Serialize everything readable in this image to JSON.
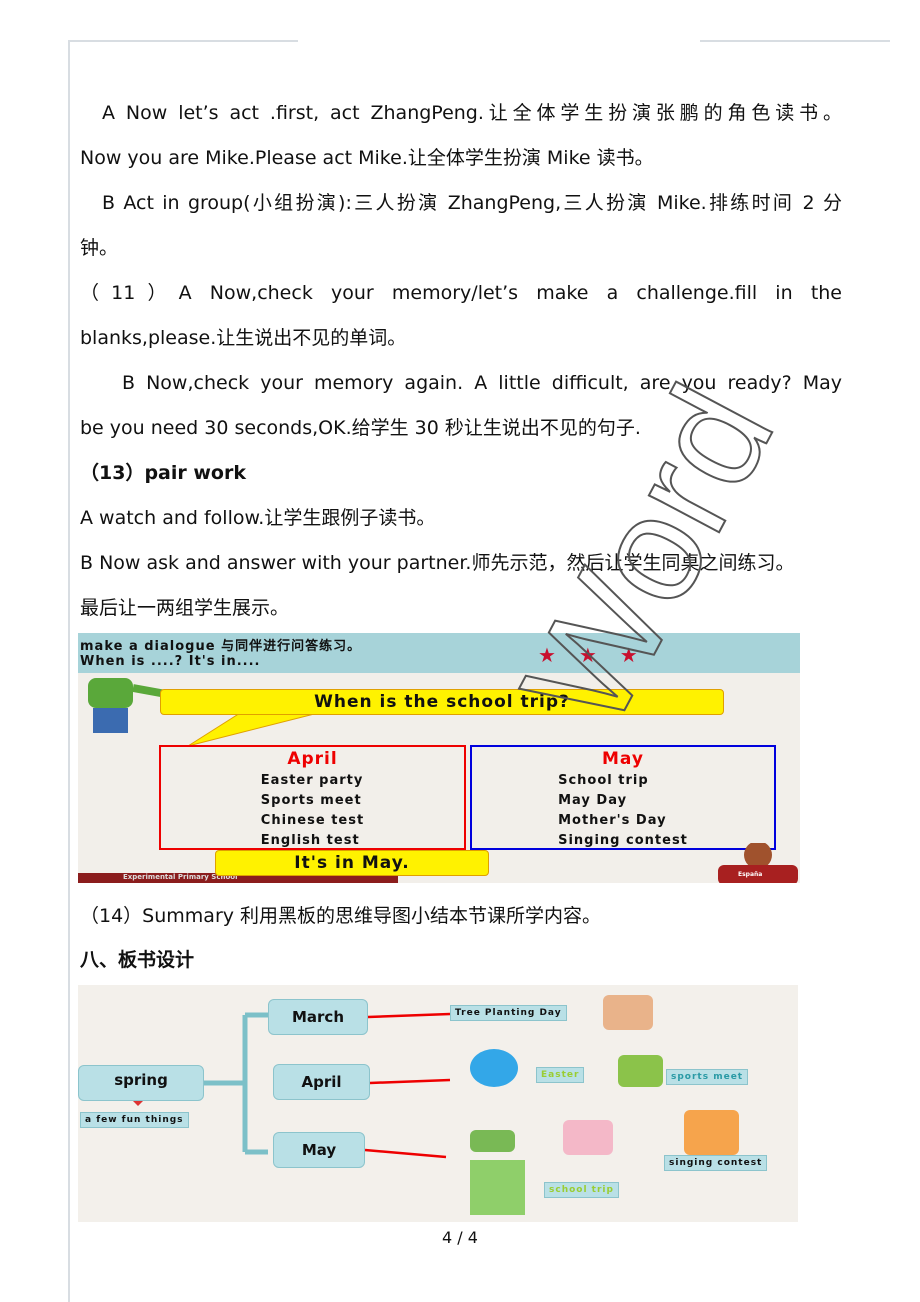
{
  "lines": [
    "A  Now  let’s  act  .first,  act  ZhangPeng.让全体学生扮演张鹏的角色读书。",
    "Now you are Mike.Please act Mike.让全体学生扮演 Mike 读书。",
    "B Act in group(小组扮演):三人扮演 ZhangPeng,三人扮演 Mike.排练时间 2 分",
    "钟。",
    "（11）A  Now,check  your  memory/let’s  make  a  challenge.fill  in  the",
    "blanks,please.让生说出不见的单词。",
    "B Now,check your memory again. A little difficult, are you ready? May",
    "be you need 30 seconds,OK.给学生 30 秒让生说出不见的句子.",
    "（13）pair work",
    "A watch and follow.让学生跟例子读书。",
    "B Now ask and answer with your partner.师先示范，然后让学生同桌之间练习。",
    "最后让一两组学生展示。"
  ],
  "slide1": {
    "instruction": "make a dialogue 与同伴进行问答练习。",
    "pattern": "When is ....?  It's in....",
    "stars": "★ ★ ★",
    "question": "When is the school trip?",
    "april": {
      "title": "April",
      "items": [
        "Easter party",
        "Sports meet",
        "Chinese test",
        "English  test"
      ]
    },
    "may": {
      "title": "May",
      "items": [
        "School trip",
        "May Day",
        "Mother's Day",
        "Singing contest"
      ]
    },
    "answer": "It's in May.",
    "footer": "Experimental Primary School",
    "shirt": "España"
  },
  "summary": "（14）Summary 利用黑板的思维导图小结本节课所学内容。",
  "section_heading": "八、板书设计",
  "mindmap": {
    "root": "spring",
    "root_tag": "a few fun things",
    "months": [
      "March",
      "April",
      "May"
    ],
    "tags": {
      "march": "Tree Planting Day",
      "easter": "Easter",
      "sports": "sports meet",
      "singing": "singing contest",
      "trip": "school trip"
    }
  },
  "watermark": "Word",
  "page_number": "4 / 4",
  "colors": {
    "slide_bar": "#a7d3d9",
    "bubble": "#fff200",
    "april_border": "#e00000",
    "may_border": "#0000d0",
    "connector": "#e00000",
    "node": "#b9e0e6"
  }
}
